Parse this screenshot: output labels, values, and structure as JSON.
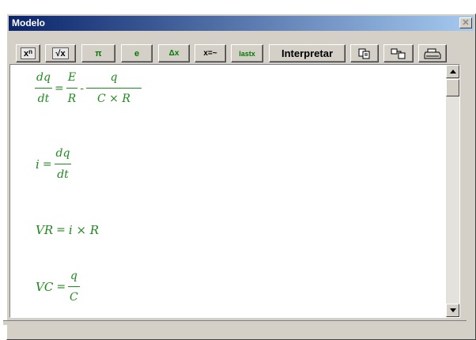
{
  "window": {
    "title": "Modelo",
    "close_glyph": "✕"
  },
  "toolbar": {
    "power": {
      "base": "x",
      "exp": "n"
    },
    "sqrt": {
      "label": "√x"
    },
    "pi": {
      "label": "π"
    },
    "e": {
      "label": "e"
    },
    "delta": {
      "label": "Δx"
    },
    "assign": {
      "label": "x=~"
    },
    "last": {
      "label": "lastx"
    },
    "interpret": {
      "label": "Interpretar"
    },
    "copy": {
      "icon": "copy-icon"
    },
    "paste": {
      "icon": "paste-icon"
    },
    "print": {
      "icon": "print-icon"
    }
  },
  "equations": {
    "eq1": {
      "lhs_num": "dq",
      "lhs_den": "dt",
      "eq": "=",
      "f1_num": "E",
      "f1_den": "R",
      "minus": "-",
      "f2_num": "q",
      "f2_den": "C × R"
    },
    "eq2": {
      "lhs": "i",
      "eq": "=",
      "num": "dq",
      "den": "dt"
    },
    "eq3": {
      "lhs": "VR",
      "eq": "=",
      "rhs": "i × R"
    },
    "eq4": {
      "lhs": "VC",
      "eq": "=",
      "num": "q",
      "den": "C"
    }
  },
  "colors": {
    "equation": "#1f8a1f",
    "titlebar_start": "#0a246a",
    "titlebar_end": "#a6caf0"
  }
}
